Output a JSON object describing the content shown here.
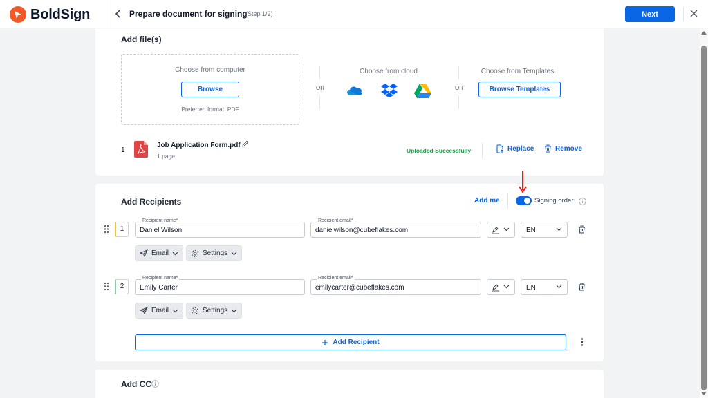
{
  "app": {
    "brand": "BoldSign",
    "brand_color": "#f05a28",
    "accent": "#0a66e4"
  },
  "header": {
    "title": "Prepare document for signing",
    "step": "(Step 1/2)",
    "next_label": "Next"
  },
  "files": {
    "title": "Add file(s)",
    "computer": {
      "title": "Choose from computer",
      "browse_label": "Browse",
      "preferred": "Preferred format: PDF"
    },
    "or_label": "OR",
    "cloud": {
      "title": "Choose from cloud",
      "icons": [
        "onedrive-icon",
        "dropbox-icon",
        "google-drive-icon"
      ]
    },
    "templates": {
      "title": "Choose from Templates",
      "browse_label": "Browse Templates"
    },
    "uploaded": [
      {
        "index": "1",
        "name": "Job Application Form.pdf",
        "pages": "1 page",
        "status": "Uploaded Successfully",
        "replace_label": "Replace",
        "remove_label": "Remove"
      }
    ]
  },
  "recipients": {
    "title": "Add Recipients",
    "add_me_label": "Add me",
    "signing_order_label": "Signing order",
    "signing_order_on": true,
    "name_label": "Recipient name*",
    "email_label": "Recipient email*",
    "list": [
      {
        "order": "1",
        "name": "Daniel Wilson",
        "email": "danielwilson@cubeflakes.com",
        "language": "EN",
        "delivery": "Email",
        "settings": "Settings",
        "marker_color": "#f5c542"
      },
      {
        "order": "2",
        "name": "Emily Carter",
        "email": "emilycarter@cubeflakes.com",
        "language": "EN",
        "delivery": "Email",
        "settings": "Settings",
        "marker_color": "#7ed3a0"
      }
    ],
    "add_recipient_label": "Add Recipient"
  },
  "cc": {
    "title": "Add CC"
  }
}
